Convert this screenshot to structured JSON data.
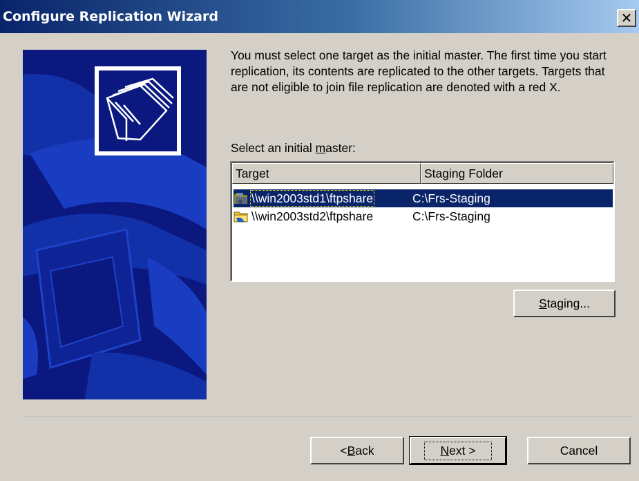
{
  "window": {
    "title": "Configure Replication Wizard",
    "close_glyph": "✕"
  },
  "banner": {
    "icon": "folders-icon",
    "colors": {
      "background": "#0a1880",
      "art": "#1a3cc0"
    }
  },
  "description": "You must select one target as the initial master. The first time you start replication, its contents are replicated to the other targets. Targets that are not eligible to join file replication are denoted with a red X.",
  "select_label": {
    "prefix": "Select an initial ",
    "mnemonic": "m",
    "suffix": "aster:"
  },
  "listview": {
    "columns": [
      "Target",
      "Staging Folder"
    ],
    "rows": [
      {
        "target": "\\\\win2003std1\\ftpshare",
        "staging": "C:\\Frs-Staging",
        "selected": true,
        "icon": "master-share-icon"
      },
      {
        "target": "\\\\win2003std2\\ftpshare",
        "staging": "C:\\Frs-Staging",
        "selected": false,
        "icon": "share-folder-icon"
      }
    ]
  },
  "buttons": {
    "staging": {
      "mnemonic": "S",
      "rest": "taging..."
    },
    "back": {
      "prefix": "< ",
      "mnemonic": "B",
      "rest": "ack"
    },
    "next": {
      "mnemonic": "N",
      "rest": "ext >"
    },
    "cancel": "Cancel"
  },
  "colors": {
    "titlebar_start": "#0a246a",
    "titlebar_end": "#a6caf0",
    "selection": "#0a246a",
    "dialog_bg": "#d4d0c8"
  }
}
